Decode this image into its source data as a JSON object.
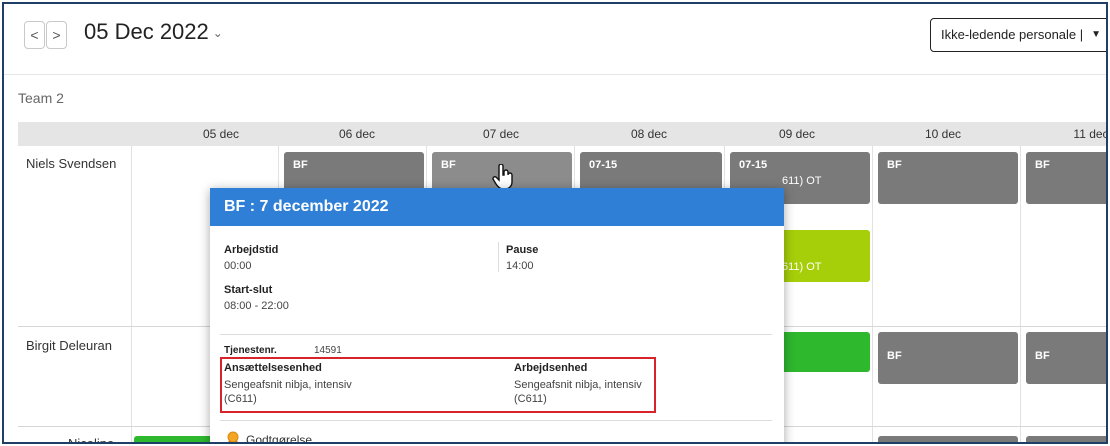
{
  "nav": {
    "prev": "<",
    "next": ">",
    "date": "05 Dec 2022",
    "date_chevron": "⌄"
  },
  "filter": {
    "value": "Ikke-ledende personale |",
    "caret": "▼"
  },
  "team": "Team 2",
  "days": [
    "05 dec",
    "06 dec",
    "07 dec",
    "08 dec",
    "09 dec",
    "10 dec",
    "11 dec"
  ],
  "rows": [
    {
      "name": "Niels Svendsen"
    },
    {
      "name": "Birgit Deleuran"
    },
    {
      "name": "Nicoline"
    }
  ],
  "shifts": {
    "bf": "BF",
    "t0715": "07-15",
    "ot": "611) OT",
    "ot2": "611) OT"
  },
  "popup": {
    "title": "BF : 7 december 2022",
    "arbejdstid_label": "Arbejdstid",
    "arbejdstid_value": "00:00",
    "pause_label": "Pause",
    "pause_value": "14:00",
    "startslut_label": "Start-slut",
    "startslut_value": "08:00 - 22:00",
    "tjenestenr_label": "Tjenestenr.",
    "tjenestenr_value": "14591",
    "ansaettelse_label": "Ansættelsesenhed",
    "ansaettelse_value1": "Sengeafsnit nibja, intensiv",
    "ansaettelse_value2": "(C611)",
    "arbejdsenhed_label": "Arbejdsenhed",
    "arbejdsenhed_value1": "Sengeafsnit nibja, intensiv",
    "arbejdsenhed_value2": "(C611)",
    "godtgorelse_label": "Godtgørelse"
  },
  "colors": {
    "accent": "#2f7fd6",
    "highlight": "#d9232a",
    "shift_gray": "#7a7a7a",
    "shift_green": "#2eb82e",
    "shift_lime": "#a6cf0a"
  }
}
